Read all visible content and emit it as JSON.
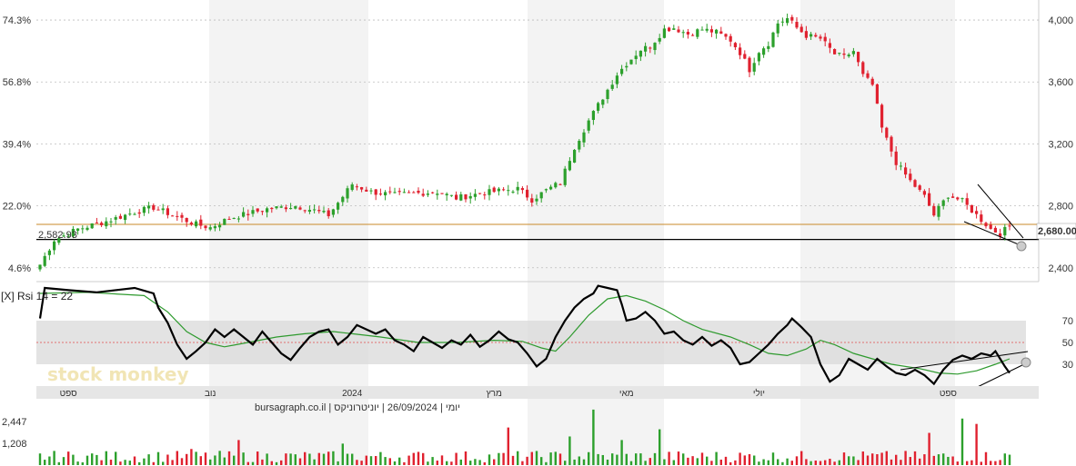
{
  "header": {
    "rsi_close": "[X]",
    "rsi_label": "Rsi 14 = 22",
    "source_line": "יומי | 26/09/2024 | יוניטרוניקס | bursagraph.co.il",
    "watermark": "stock monkey"
  },
  "colors": {
    "up": "#2ca02c",
    "down": "#e0212f",
    "rsi": "#000000",
    "rsi_ma": "#2e9a2e",
    "baseline": "#c98a2a",
    "band": "#d9d9d9"
  },
  "chart_data": [
    {
      "type": "candlestick",
      "name": "price",
      "y_left_ticks": [
        "74.3%",
        "56.8%",
        "39.4%",
        "22.0%",
        "4.6%"
      ],
      "y_right_ticks": [
        "4,000",
        "3,600",
        "3,200",
        "2,800",
        "2,400"
      ],
      "ylim": [
        2340,
        4100
      ],
      "reference_price": "2,582.93",
      "reference_level": 2582.93,
      "baseline_level": 2680,
      "last_price_label": "2,680.00",
      "path": [
        [
          0,
          2420
        ],
        [
          3,
          2580
        ],
        [
          8,
          2650
        ],
        [
          14,
          2700
        ],
        [
          20,
          2760
        ],
        [
          24,
          2790
        ],
        [
          28,
          2740
        ],
        [
          33,
          2680
        ],
        [
          36,
          2660
        ],
        [
          40,
          2720
        ],
        [
          44,
          2750
        ],
        [
          48,
          2780
        ],
        [
          54,
          2800
        ],
        [
          58,
          2770
        ],
        [
          61,
          2740
        ],
        [
          63,
          2820
        ],
        [
          66,
          2940
        ],
        [
          70,
          2890
        ],
        [
          75,
          2870
        ],
        [
          79,
          2880
        ],
        [
          84,
          2890
        ],
        [
          88,
          2850
        ],
        [
          93,
          2880
        ],
        [
          98,
          2900
        ],
        [
          101,
          2910
        ],
        [
          104,
          2840
        ],
        [
          107,
          2900
        ],
        [
          110,
          2950
        ],
        [
          113,
          3180
        ],
        [
          116,
          3350
        ],
        [
          119,
          3500
        ],
        [
          122,
          3650
        ],
        [
          124,
          3720
        ],
        [
          127,
          3810
        ],
        [
          129,
          3830
        ],
        [
          132,
          3940
        ],
        [
          134,
          3950
        ],
        [
          137,
          3910
        ],
        [
          140,
          3940
        ],
        [
          143,
          3920
        ],
        [
          146,
          3870
        ],
        [
          148,
          3790
        ],
        [
          150,
          3680
        ],
        [
          152,
          3800
        ],
        [
          154,
          3850
        ],
        [
          156,
          3980
        ],
        [
          158,
          4010
        ],
        [
          160,
          3950
        ],
        [
          162,
          3900
        ],
        [
          165,
          3880
        ],
        [
          168,
          3780
        ],
        [
          170,
          3760
        ],
        [
          172,
          3800
        ],
        [
          174,
          3640
        ],
        [
          176,
          3580
        ],
        [
          178,
          3300
        ],
        [
          181,
          3080
        ],
        [
          184,
          2960
        ],
        [
          187,
          2860
        ],
        [
          189,
          2740
        ],
        [
          192,
          2870
        ],
        [
          195,
          2830
        ],
        [
          198,
          2740
        ],
        [
          201,
          2650
        ],
        [
          203,
          2620
        ],
        [
          205,
          2670
        ]
      ]
    },
    {
      "type": "line",
      "name": "rsi",
      "title": "Rsi 14 = 22",
      "yticks": [
        "70",
        "50",
        "30"
      ],
      "ylim": [
        0,
        100
      ],
      "band": [
        30,
        70
      ],
      "midline": 50,
      "rsi": [
        [
          0,
          72
        ],
        [
          1,
          100
        ],
        [
          6,
          98
        ],
        [
          12,
          96
        ],
        [
          20,
          100
        ],
        [
          24,
          95
        ],
        [
          25,
          82
        ],
        [
          27,
          68
        ],
        [
          29,
          48
        ],
        [
          31,
          35
        ],
        [
          33,
          42
        ],
        [
          35,
          50
        ],
        [
          37,
          62
        ],
        [
          39,
          55
        ],
        [
          41,
          62
        ],
        [
          43,
          55
        ],
        [
          45,
          48
        ],
        [
          47,
          60
        ],
        [
          49,
          50
        ],
        [
          51,
          40
        ],
        [
          53,
          34
        ],
        [
          55,
          45
        ],
        [
          57,
          55
        ],
        [
          59,
          60
        ],
        [
          61,
          62
        ],
        [
          63,
          48
        ],
        [
          65,
          55
        ],
        [
          67,
          66
        ],
        [
          69,
          62
        ],
        [
          71,
          58
        ],
        [
          73,
          62
        ],
        [
          75,
          52
        ],
        [
          77,
          48
        ],
        [
          79,
          42
        ],
        [
          81,
          55
        ],
        [
          83,
          50
        ],
        [
          85,
          45
        ],
        [
          87,
          52
        ],
        [
          89,
          48
        ],
        [
          91,
          57
        ],
        [
          93,
          46
        ],
        [
          95,
          52
        ],
        [
          97,
          60
        ],
        [
          99,
          53
        ],
        [
          101,
          50
        ],
        [
          103,
          40
        ],
        [
          105,
          28
        ],
        [
          107,
          35
        ],
        [
          109,
          55
        ],
        [
          111,
          70
        ],
        [
          113,
          82
        ],
        [
          115,
          90
        ],
        [
          117,
          95
        ],
        [
          118,
          102
        ],
        [
          120,
          100
        ],
        [
          122,
          98
        ],
        [
          123,
          85
        ],
        [
          124,
          70
        ],
        [
          126,
          72
        ],
        [
          128,
          78
        ],
        [
          130,
          70
        ],
        [
          132,
          58
        ],
        [
          134,
          60
        ],
        [
          136,
          52
        ],
        [
          138,
          48
        ],
        [
          140,
          55
        ],
        [
          142,
          47
        ],
        [
          144,
          52
        ],
        [
          146,
          45
        ],
        [
          148,
          30
        ],
        [
          150,
          32
        ],
        [
          152,
          40
        ],
        [
          154,
          48
        ],
        [
          156,
          58
        ],
        [
          158,
          66
        ],
        [
          159,
          72
        ],
        [
          161,
          64
        ],
        [
          163,
          55
        ],
        [
          165,
          30
        ],
        [
          167,
          14
        ],
        [
          169,
          20
        ],
        [
          171,
          35
        ],
        [
          173,
          30
        ],
        [
          175,
          25
        ],
        [
          177,
          35
        ],
        [
          179,
          28
        ],
        [
          181,
          22
        ],
        [
          183,
          20
        ],
        [
          185,
          25
        ],
        [
          187,
          20
        ],
        [
          189,
          12
        ],
        [
          191,
          25
        ],
        [
          193,
          34
        ],
        [
          195,
          38
        ],
        [
          197,
          35
        ],
        [
          199,
          40
        ],
        [
          201,
          38
        ],
        [
          202,
          42
        ],
        [
          203,
          35
        ],
        [
          204,
          28
        ],
        [
          205,
          22
        ]
      ],
      "rsi_ma": [
        [
          0,
          95
        ],
        [
          10,
          96
        ],
        [
          22,
          93
        ],
        [
          27,
          78
        ],
        [
          31,
          60
        ],
        [
          35,
          50
        ],
        [
          39,
          46
        ],
        [
          44,
          50
        ],
        [
          50,
          55
        ],
        [
          56,
          58
        ],
        [
          62,
          60
        ],
        [
          66,
          58
        ],
        [
          72,
          55
        ],
        [
          80,
          50
        ],
        [
          88,
          50
        ],
        [
          96,
          52
        ],
        [
          102,
          51
        ],
        [
          106,
          45
        ],
        [
          109,
          42
        ],
        [
          112,
          55
        ],
        [
          116,
          75
        ],
        [
          120,
          90
        ],
        [
          124,
          93
        ],
        [
          128,
          88
        ],
        [
          132,
          80
        ],
        [
          136,
          70
        ],
        [
          140,
          62
        ],
        [
          146,
          55
        ],
        [
          150,
          48
        ],
        [
          154,
          40
        ],
        [
          158,
          38
        ],
        [
          162,
          44
        ],
        [
          165,
          52
        ],
        [
          168,
          48
        ],
        [
          172,
          40
        ],
        [
          176,
          35
        ],
        [
          180,
          30
        ],
        [
          186,
          26
        ],
        [
          190,
          22
        ],
        [
          194,
          21
        ],
        [
          198,
          24
        ],
        [
          202,
          30
        ],
        [
          205,
          35
        ]
      ]
    },
    {
      "type": "bar",
      "name": "volume",
      "yticks": [
        "2,447",
        "1,208"
      ],
      "ylim": [
        0,
        3400
      ],
      "spikes": [
        [
          32,
          900
        ],
        [
          42,
          1400
        ],
        [
          64,
          1200
        ],
        [
          99,
          2100
        ],
        [
          112,
          1600
        ],
        [
          117,
          3100
        ],
        [
          123,
          1400
        ],
        [
          131,
          2000
        ],
        [
          188,
          1800
        ],
        [
          195,
          2600
        ],
        [
          198,
          2300
        ]
      ]
    }
  ],
  "x_axis": {
    "labels": [
      "ספט",
      "נוב",
      "2024",
      "מרץ",
      "מאי",
      "יולי",
      "ספט"
    ],
    "label_positions": [
      6,
      36,
      66,
      96,
      124,
      152,
      192
    ]
  }
}
